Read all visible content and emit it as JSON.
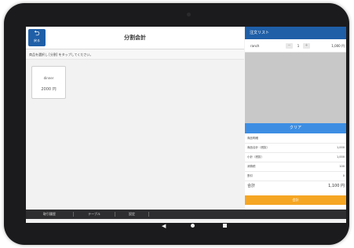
{
  "header": {
    "back_label": "戻る",
    "title": "分割会計"
  },
  "instruction": "商品を選択し [分割] をタップしてください。",
  "items": [
    {
      "name": "dinner",
      "price": "2000 円"
    }
  ],
  "order": {
    "header": "注文リスト",
    "rows": [
      {
        "name": "ranch",
        "minus": "−",
        "qty": "1",
        "plus": "+",
        "price": "1,000 円"
      }
    ],
    "clear_label": "クリア"
  },
  "summary": {
    "rows": [
      {
        "label": "商品明細",
        "value": ""
      },
      {
        "label": "商品合計（税抜）",
        "value": "1,000"
      },
      {
        "label": "小計（税抜）",
        "value": "1,000"
      },
      {
        "label": "消費税",
        "value": "100"
      },
      {
        "label": "割引",
        "value": "0"
      }
    ],
    "total_label": "合計",
    "total_value": "1,100 円",
    "checkout_label": "会計"
  },
  "bottom_nav": [
    "取引履歴",
    "テーブル",
    "設定"
  ],
  "system_nav": {
    "back_glyph": "◀"
  },
  "colors": {
    "primary": "#1f5fa8",
    "clear": "#3d8ee3",
    "checkout": "#f5a623"
  }
}
